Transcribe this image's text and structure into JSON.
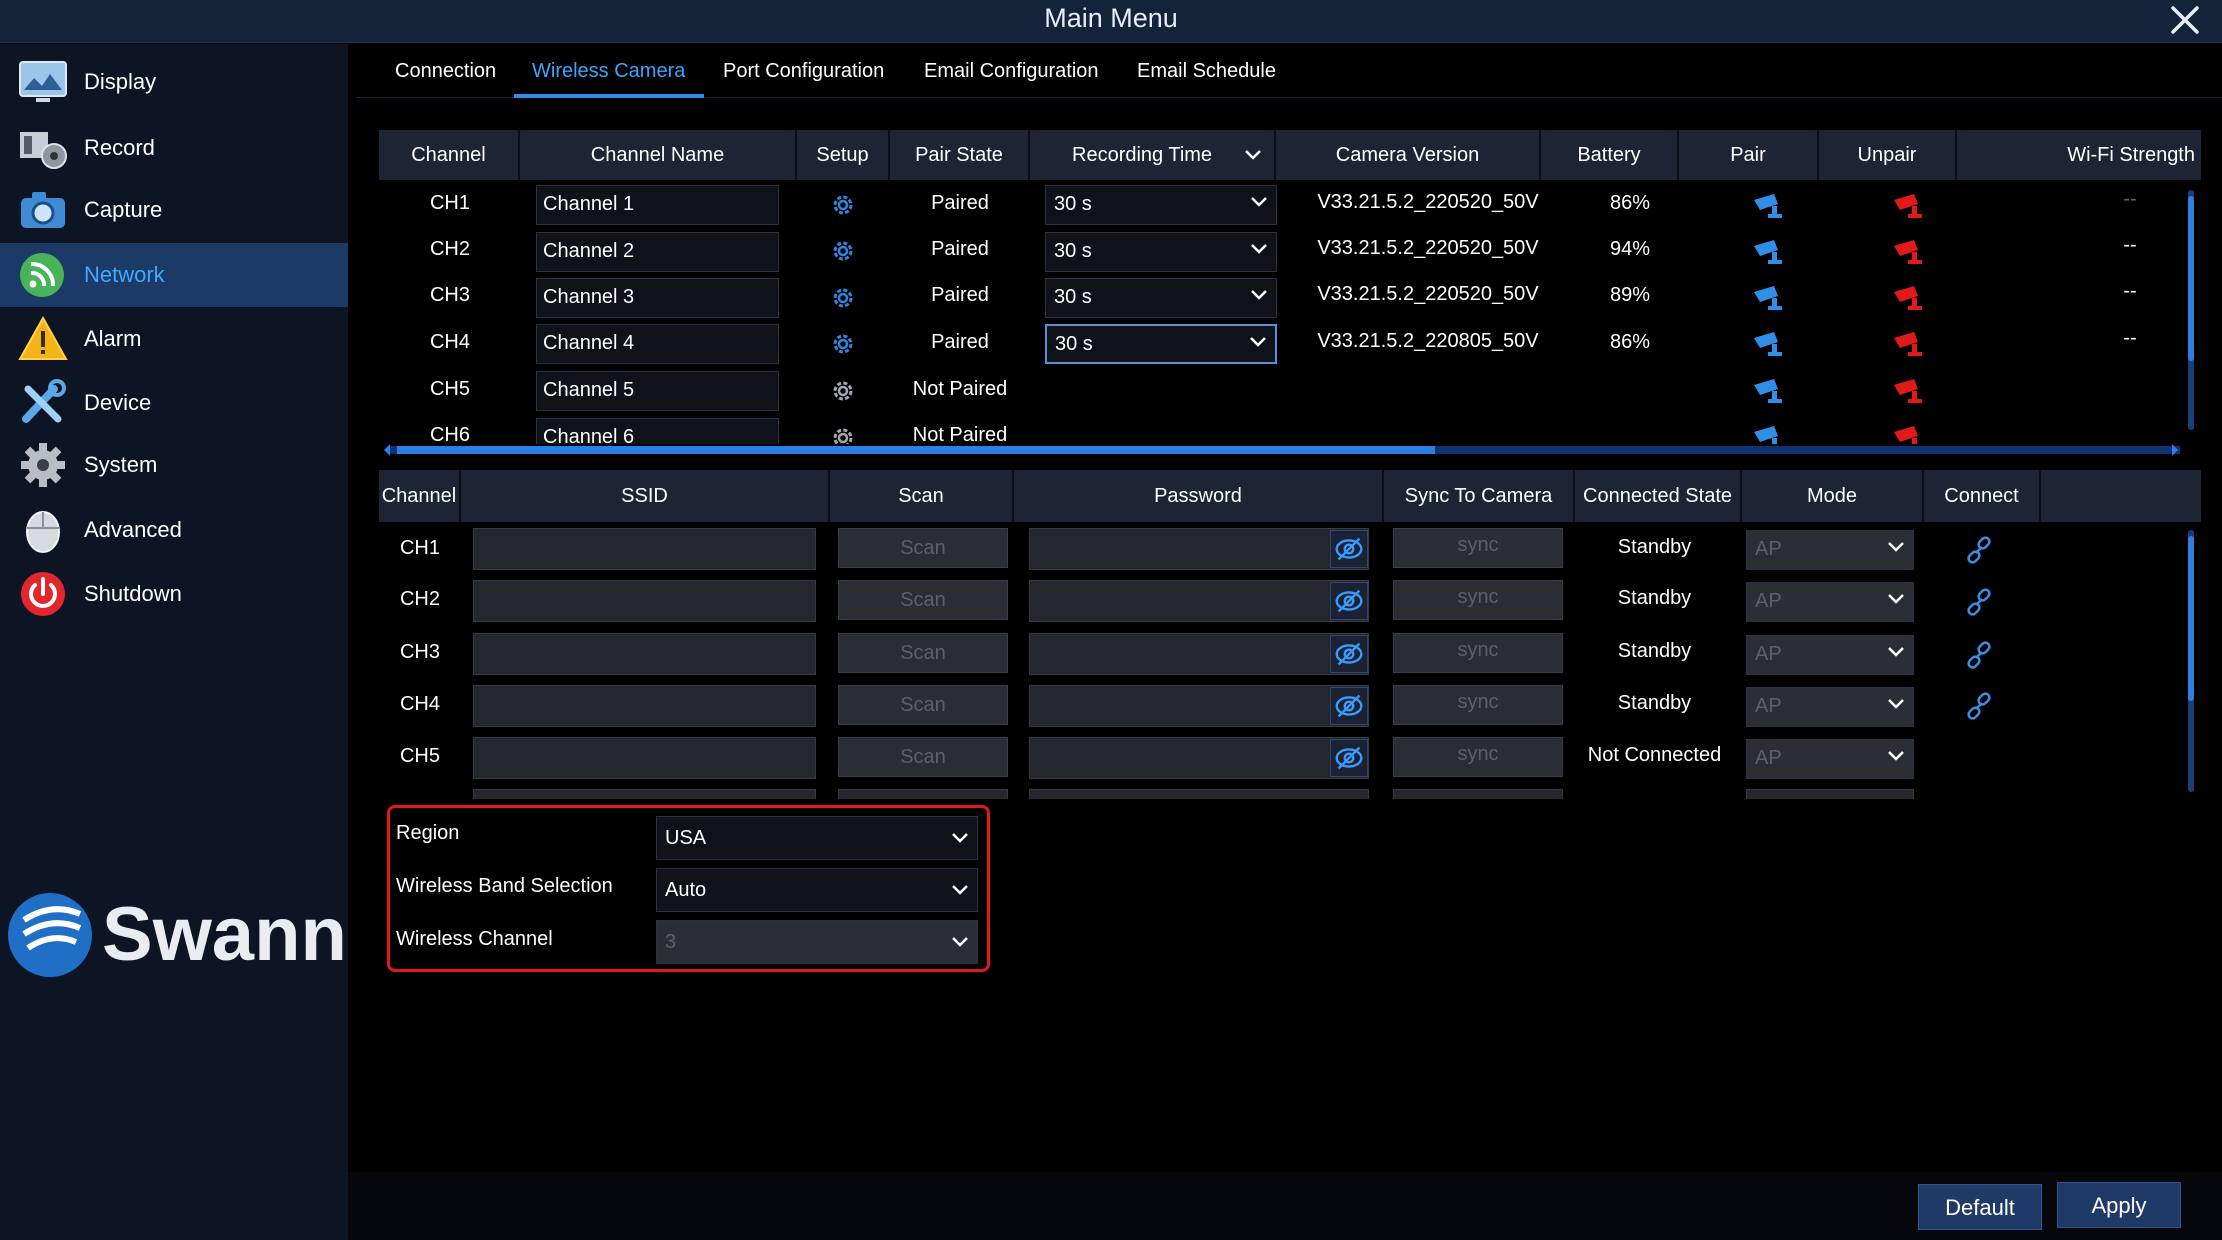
{
  "window": {
    "title": "Main Menu"
  },
  "sidebar": {
    "items": [
      {
        "label": "Display",
        "icon": "display-icon"
      },
      {
        "label": "Record",
        "icon": "record-icon"
      },
      {
        "label": "Capture",
        "icon": "camera-icon"
      },
      {
        "label": "Network",
        "icon": "network-icon",
        "active": true
      },
      {
        "label": "Alarm",
        "icon": "alarm-icon"
      },
      {
        "label": "Device",
        "icon": "device-tools-icon"
      },
      {
        "label": "System",
        "icon": "gear-icon"
      },
      {
        "label": "Advanced",
        "icon": "mouse-icon"
      },
      {
        "label": "Shutdown",
        "icon": "power-icon"
      }
    ],
    "brand": "Swann"
  },
  "tabs": [
    {
      "label": "Connection"
    },
    {
      "label": "Wireless Camera",
      "active": true
    },
    {
      "label": "Port Configuration"
    },
    {
      "label": "Email Configuration"
    },
    {
      "label": "Email Schedule"
    }
  ],
  "camera_table": {
    "headers": {
      "channel": "Channel",
      "channel_name": "Channel Name",
      "setup": "Setup",
      "pair_state": "Pair State",
      "recording_time": "Recording Time",
      "camera_version": "Camera Version",
      "battery": "Battery",
      "pair": "Pair",
      "unpair": "Unpair",
      "wifi_strength": "Wi-Fi Strength"
    },
    "rows": [
      {
        "channel": "CH1",
        "name": "Channel 1",
        "pair_state": "Paired",
        "recording_time": "30 s",
        "version": "V33.21.5.2_220520_50V",
        "battery": "86%",
        "wifi": "--"
      },
      {
        "channel": "CH2",
        "name": "Channel 2",
        "pair_state": "Paired",
        "recording_time": "30 s",
        "version": "V33.21.5.2_220520_50V",
        "battery": "94%",
        "wifi": "--"
      },
      {
        "channel": "CH3",
        "name": "Channel 3",
        "pair_state": "Paired",
        "recording_time": "30 s",
        "version": "V33.21.5.2_220520_50V",
        "battery": "89%",
        "wifi": "--"
      },
      {
        "channel": "CH4",
        "name": "Channel 4",
        "pair_state": "Paired",
        "recording_time": "30 s",
        "version": "V33.21.5.2_220805_50V",
        "battery": "86%",
        "wifi": "--"
      },
      {
        "channel": "CH5",
        "name": "Channel 5",
        "pair_state": "Not Paired"
      },
      {
        "channel": "CH6",
        "name": "Channel 6",
        "pair_state": "Not Paired"
      }
    ]
  },
  "wifi_table": {
    "headers": {
      "channel": "Channel",
      "ssid": "SSID",
      "scan": "Scan",
      "password": "Password",
      "sync": "Sync To Camera",
      "connected_state": "Connected State",
      "mode": "Mode",
      "connect": "Connect"
    },
    "scan_label": "Scan",
    "sync_label": "sync",
    "rows": [
      {
        "channel": "CH1",
        "state": "Standby",
        "mode": "AP"
      },
      {
        "channel": "CH2",
        "state": "Standby",
        "mode": "AP"
      },
      {
        "channel": "CH3",
        "state": "Standby",
        "mode": "AP"
      },
      {
        "channel": "CH4",
        "state": "Standby",
        "mode": "AP"
      },
      {
        "channel": "CH5",
        "state": "Not Connected",
        "mode": "AP"
      }
    ]
  },
  "settings": {
    "region_label": "Region",
    "region_value": "USA",
    "band_label": "Wireless Band Selection",
    "band_value": "Auto",
    "channel_label": "Wireless Channel",
    "channel_value": "3"
  },
  "buttons": {
    "default": "Default",
    "apply": "Apply"
  },
  "colors": {
    "accent": "#3aa4ff",
    "pair": "#2f8fe6",
    "unpair": "#e01a1a",
    "highlight_box": "#e01a1a"
  }
}
